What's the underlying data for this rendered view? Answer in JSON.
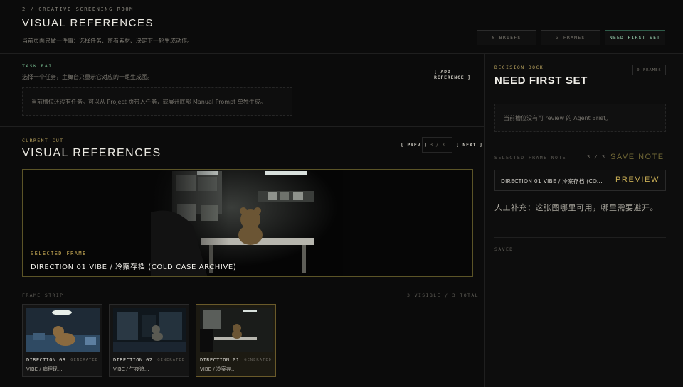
{
  "header": {
    "eyebrow": "2 / CREATIVE SCREENING ROOM",
    "title": "VISUAL REFERENCES",
    "subtitle": "当前页面只做一件事：选择任务、监看素材、决定下一轮生成动作。",
    "buttons": [
      {
        "label": "0 BRIEFS",
        "active": false
      },
      {
        "label": "3 FRAMES",
        "active": false
      },
      {
        "label": "NEED FIRST SET",
        "active": true
      }
    ]
  },
  "task_rail": {
    "label": "TASK RAIL",
    "note": "选择一个任务，主舞台只显示它对应的一组生成图。",
    "add_reference": "[ ADD REFERENCE ]",
    "empty_message": "当前槽位还没有任务。可以从 Project 页带入任务，或展开底部 Manual Prompt 单独生成。"
  },
  "current_cut": {
    "label": "CURRENT CUT",
    "title": "VISUAL REFERENCES",
    "prev": "[ PREV ]",
    "next": "[ NEXT ]",
    "counter": "3 / 3",
    "selected_label": "SELECTED FRAME",
    "selected_title": "DIRECTION 01 VIBE / 冷案存档 (COLD CASE ARCHIVE)"
  },
  "frame_strip": {
    "label": "FRAME STRIP",
    "count": "3 VISIBLE / 3 TOTAL",
    "items": [
      {
        "title": "DIRECTION 03",
        "subtitle": "VIBE / 病理现...",
        "tag": "GENERATED",
        "selected": false
      },
      {
        "title": "DIRECTION 02",
        "subtitle": "VIBE / 午夜追...",
        "tag": "GENERATED",
        "selected": false
      },
      {
        "title": "DIRECTION 01",
        "subtitle": "VIBE / 冷案存...",
        "tag": "GENERATED",
        "selected": true
      }
    ]
  },
  "decision_dock": {
    "label": "DECISION DOCK",
    "title": "NEED FIRST SET",
    "frames_badge": "0 FRAMES",
    "empty_message": "当前槽位没有可 review 的 Agent Brief。",
    "note_label": "SELECTED FRAME NOTE",
    "note_count": "3 / 3",
    "save_note": "SAVE NOTE",
    "selected_frame": "DIRECTION 01 VIBE / 冷案存档 (CO...",
    "preview": "PREVIEW",
    "note_placeholder": "人工补充：这张图哪里可用，哪里需要避开。",
    "saved_label": "SAVED"
  },
  "colors": {
    "accent_gold": "#c9ae55",
    "accent_green": "#6fae86",
    "background": "#0b0b0b"
  }
}
